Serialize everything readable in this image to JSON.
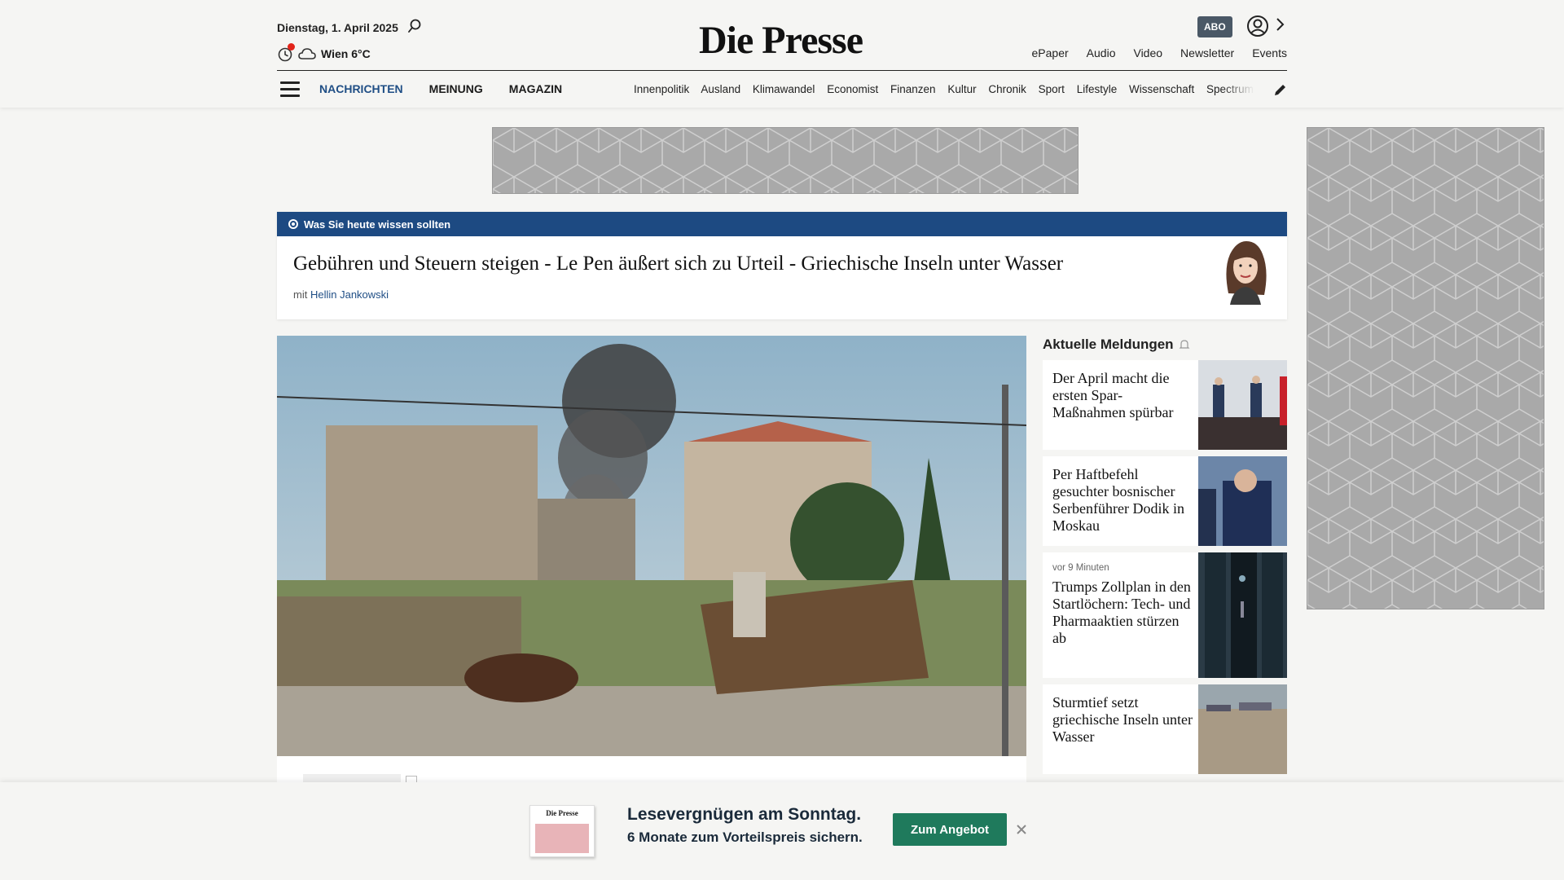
{
  "header": {
    "date": "Dienstag, 1. April 2025",
    "weather": "Wien 6°C",
    "logo": "Die Presse",
    "abo_label": "ABO",
    "service_links": [
      "ePaper",
      "Audio",
      "Video",
      "Newsletter",
      "Events"
    ],
    "main_nav": [
      "NACHRICHTEN",
      "MEINUNG",
      "MAGAZIN"
    ],
    "sub_nav": [
      "Innenpolitik",
      "Ausland",
      "Klimawandel",
      "Economist",
      "Finanzen",
      "Kultur",
      "Chronik",
      "Sport",
      "Lifestyle",
      "Wissenschaft",
      "Spectrum"
    ],
    "accent_color": "#1f4e85"
  },
  "briefing": {
    "label": "Was Sie heute wissen sollten",
    "headline": "Gebühren und Steuern steigen - Le Pen äußert sich zu Urteil - Griechische Inseln unter Wasser",
    "by_prefix": "mit",
    "author": "Hellin Jankowski",
    "bar_color": "#1d4a82"
  },
  "news": {
    "heading": "Aktuelle Meldungen",
    "items": [
      {
        "time": "",
        "title": "Der April macht die ersten Spar-Maßnahmen spürbar"
      },
      {
        "time": "",
        "title": "Per Haftbefehl gesuchter bosnischer Serbenführer Dodik in Moskau"
      },
      {
        "time": "vor 9 Minuten",
        "title": "Trumps Zollplan in den Startlöchern: Tech- und Pharmaaktien stürzen ab"
      },
      {
        "time": "",
        "title": "Sturmtief setzt griechische Inseln unter Wasser"
      }
    ]
  },
  "promo": {
    "mast": "Die Presse",
    "title": "Lesevergnügen am Sonntag.",
    "subtitle": "6 Monate zum Vorteilspreis sichern.",
    "button": "Zum Angebot",
    "button_color": "#1f7a5c"
  },
  "icons": [
    "search-icon",
    "clock-icon",
    "cloud-icon",
    "account-icon",
    "chevron-right-icon",
    "hamburger-icon",
    "pencil-icon",
    "bell-icon",
    "close-icon"
  ]
}
